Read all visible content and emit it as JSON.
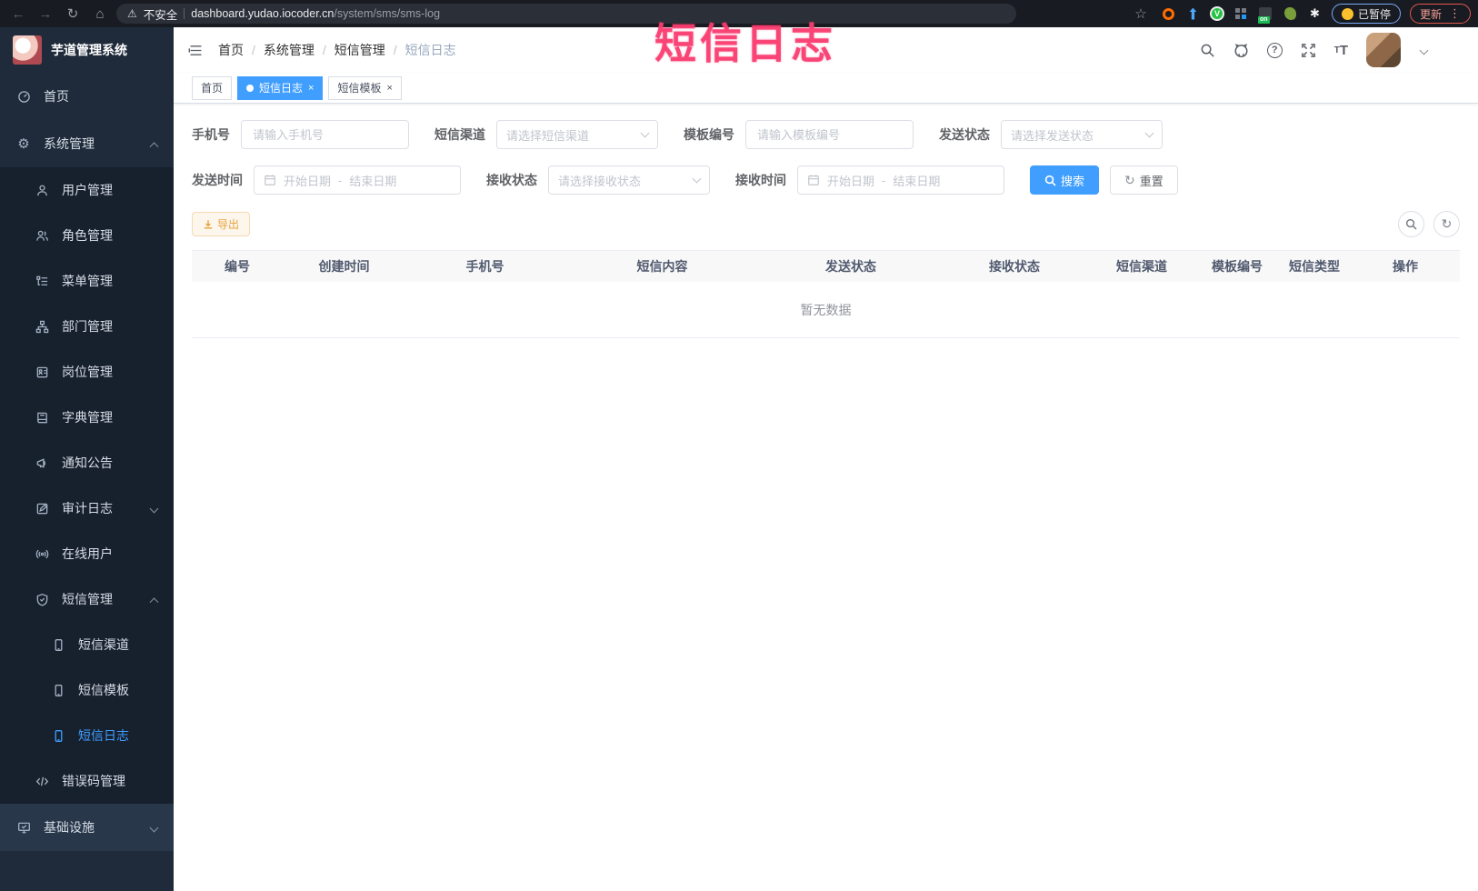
{
  "browser": {
    "security_warning": "不安全",
    "url_domain": "dashboard.yudao.iocoder.cn",
    "url_path": "/system/sms/sms-log",
    "extension_on_badge": "on",
    "extension_v_label": "V",
    "paused_badge": "已暂停",
    "update_button": "更新"
  },
  "annotation": {
    "title": "短信日志"
  },
  "sidebar": {
    "app_title": "芋道管理系统",
    "items": [
      {
        "label": "首页",
        "icon": "dashboard-icon"
      },
      {
        "label": "系统管理",
        "icon": "gear-icon",
        "expanded": true,
        "children": [
          {
            "label": "用户管理",
            "icon": "user-icon"
          },
          {
            "label": "角色管理",
            "icon": "users-icon"
          },
          {
            "label": "菜单管理",
            "icon": "menu-tree-icon"
          },
          {
            "label": "部门管理",
            "icon": "org-tree-icon"
          },
          {
            "label": "岗位管理",
            "icon": "badge-icon"
          },
          {
            "label": "字典管理",
            "icon": "book-icon"
          },
          {
            "label": "通知公告",
            "icon": "megaphone-icon"
          },
          {
            "label": "审计日志",
            "icon": "log-icon",
            "collapsed": true
          },
          {
            "label": "在线用户",
            "icon": "broadcast-icon"
          },
          {
            "label": "短信管理",
            "icon": "shield-icon",
            "expanded": true,
            "children": [
              {
                "label": "短信渠道",
                "icon": "mobile-icon"
              },
              {
                "label": "短信模板",
                "icon": "mobile-icon"
              },
              {
                "label": "短信日志",
                "icon": "mobile-icon",
                "active": true
              }
            ]
          },
          {
            "label": "错误码管理",
            "icon": "code-icon"
          }
        ]
      },
      {
        "label": "基础设施",
        "icon": "monitor-icon",
        "collapsed": true
      }
    ]
  },
  "breadcrumb": {
    "items": [
      "首页",
      "系统管理",
      "短信管理",
      "短信日志"
    ]
  },
  "tabs": [
    {
      "label": "首页"
    },
    {
      "label": "短信日志",
      "active": true,
      "close": "×"
    },
    {
      "label": "短信模板",
      "close": "×"
    }
  ],
  "filters": {
    "row1": [
      {
        "label": "手机号",
        "placeholder": "请输入手机号"
      },
      {
        "label": "短信渠道",
        "placeholder": "请选择短信渠道"
      },
      {
        "label": "模板编号",
        "placeholder": "请输入模板编号"
      },
      {
        "label": "发送状态",
        "placeholder": "请选择发送状态"
      }
    ],
    "row2": [
      {
        "label": "发送时间",
        "start": "开始日期",
        "end": "结束日期"
      },
      {
        "label": "接收状态",
        "placeholder": "请选择接收状态"
      },
      {
        "label": "接收时间",
        "start": "开始日期",
        "end": "结束日期"
      }
    ],
    "range_separator": "-",
    "search_label": "搜索",
    "reset_label": "重置"
  },
  "toolbar": {
    "export_label": "导出"
  },
  "table": {
    "columns": [
      "编号",
      "创建时间",
      "手机号",
      "短信内容",
      "发送状态",
      "接收状态",
      "短信渠道",
      "模板编号",
      "短信类型",
      "操作"
    ],
    "empty_text": "暂无数据"
  },
  "colors": {
    "accent_blue": "#409eff",
    "warning_orange": "#e6a23c",
    "annotation_pink": "#fa3c70",
    "sidebar_bg": "#1f2b3a",
    "submenu_bg": "#17202d"
  }
}
